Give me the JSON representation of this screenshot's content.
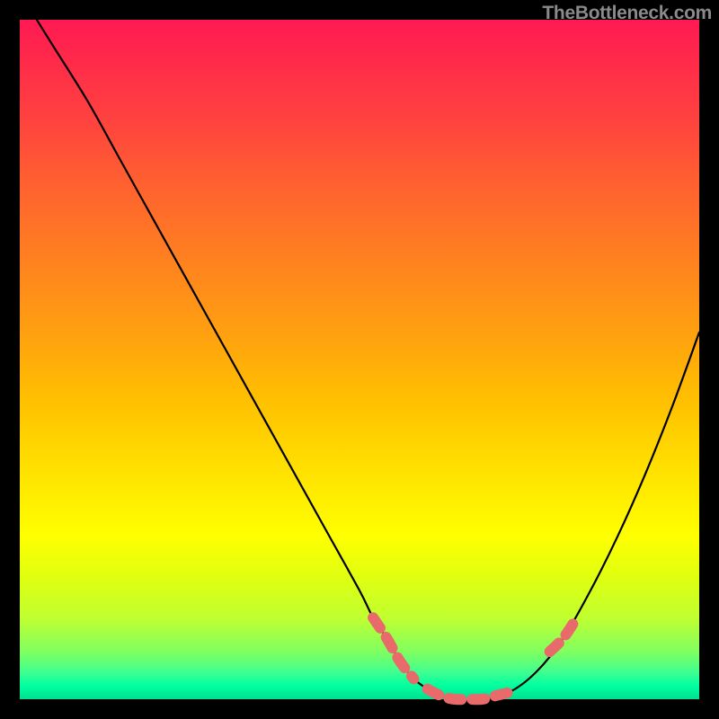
{
  "watermark": "TheBottleneck.com",
  "chart_data": {
    "type": "line",
    "title": "",
    "xlabel": "",
    "ylabel": "",
    "xlim": [
      0,
      100
    ],
    "ylim": [
      0,
      100
    ],
    "series": [
      {
        "name": "bottleneck-curve",
        "x": [
          0,
          5,
          10,
          15,
          20,
          25,
          30,
          35,
          40,
          45,
          50,
          52,
          54,
          56,
          58,
          60,
          62,
          64,
          68,
          72,
          76,
          80,
          84,
          88,
          92,
          96,
          100
        ],
        "y": [
          104,
          96,
          88,
          79,
          70,
          61,
          52,
          43,
          34,
          25,
          16,
          12,
          9,
          5.5,
          3,
          1.5,
          0.5,
          0,
          0,
          1,
          4,
          9,
          16,
          24,
          33,
          43,
          54
        ]
      }
    ],
    "highlight": {
      "color": "#e86a6a",
      "segments": [
        {
          "x": [
            52,
            54,
            56,
            58
          ],
          "y": [
            12,
            9,
            5.5,
            3
          ]
        },
        {
          "x": [
            60,
            62,
            64,
            66,
            68,
            70,
            72
          ],
          "y": [
            1.5,
            0.5,
            0,
            0,
            0,
            0.5,
            1
          ]
        },
        {
          "x": [
            78,
            80,
            82
          ],
          "y": [
            7,
            9,
            12
          ]
        }
      ]
    }
  }
}
